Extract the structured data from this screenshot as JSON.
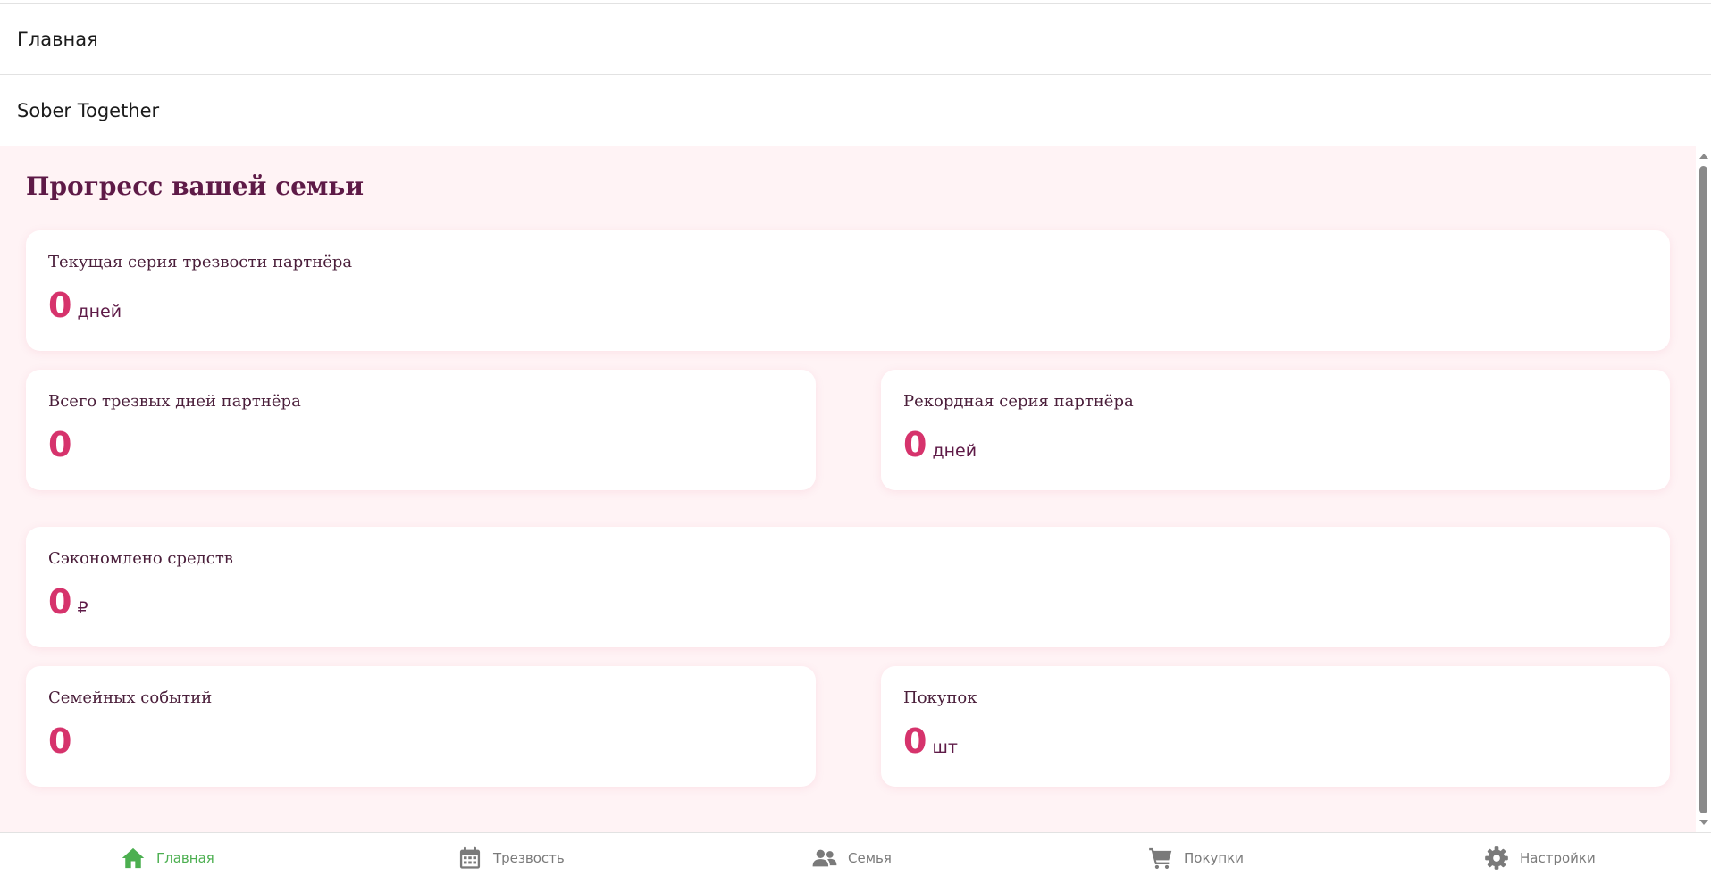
{
  "header": {
    "page_title": "Главная",
    "app_title": "Sober Together"
  },
  "main": {
    "heading": "Прогресс вашей семьи",
    "cards": [
      {
        "label": "Текущая серия трезвости партнёра",
        "value": "0",
        "unit": "дней"
      },
      {
        "label": "Всего трезвых дней партнёра",
        "value": "0",
        "unit": ""
      },
      {
        "label": "Рекордная серия партнёра",
        "value": "0",
        "unit": "дней"
      },
      {
        "label": "Сэкономлено средств",
        "value": "0",
        "unit": "₽"
      },
      {
        "label": "Семейных событий",
        "value": "0",
        "unit": ""
      },
      {
        "label": "Покупок",
        "value": "0",
        "unit": "шт"
      }
    ]
  },
  "bottom_nav": {
    "items": [
      {
        "label": "Главная",
        "icon": "home-icon",
        "active": true
      },
      {
        "label": "Трезвость",
        "icon": "calendar-icon",
        "active": false
      },
      {
        "label": "Семья",
        "icon": "users-icon",
        "active": false
      },
      {
        "label": "Покупки",
        "icon": "cart-icon",
        "active": false
      },
      {
        "label": "Настройки",
        "icon": "gear-icon",
        "active": false
      }
    ]
  },
  "colors": {
    "accent_value": "#d6336c",
    "heading": "#5e1a47",
    "content_background": "#fff3f5",
    "nav_active": "#4caf50",
    "nav_inactive": "#7a7a7a"
  }
}
